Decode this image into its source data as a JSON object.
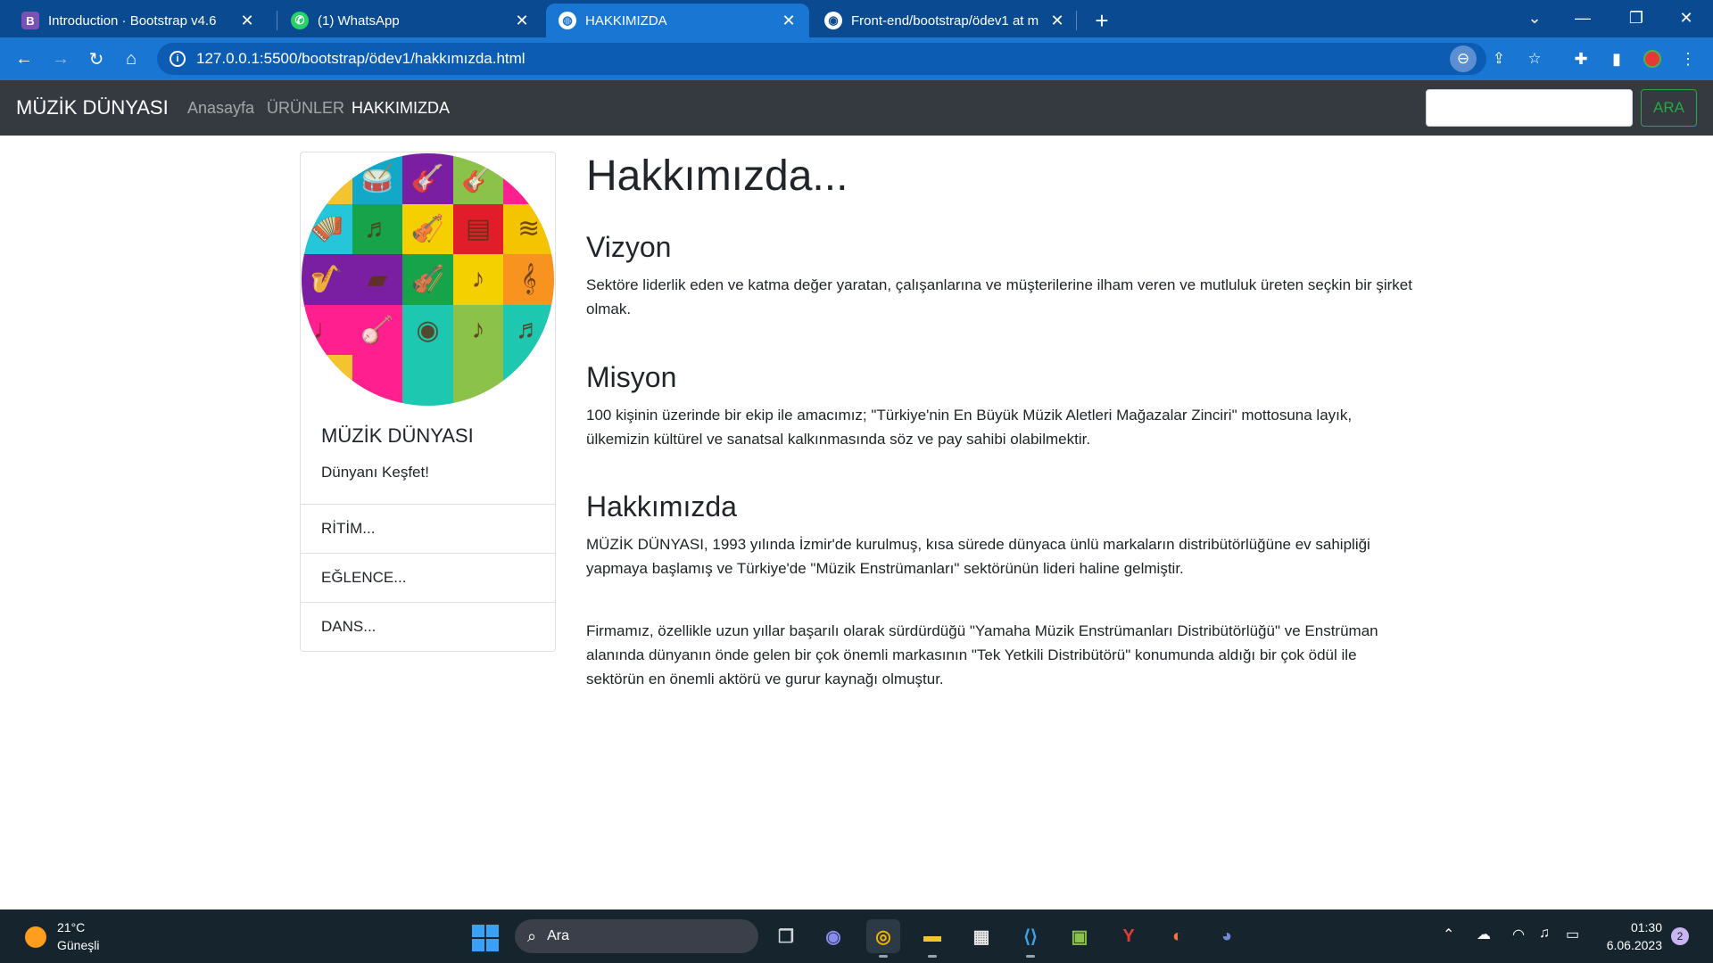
{
  "browser": {
    "tabs": [
      {
        "title": "Introduction · Bootstrap v4.6",
        "favicon": "bootstrap-icon",
        "color": "#7952b3"
      },
      {
        "title": "(1) WhatsApp",
        "favicon": "whatsapp-icon",
        "color": "#25d366"
      },
      {
        "title": "HAKKIMIZDA",
        "favicon": "globe-icon",
        "color": "#ffffff"
      },
      {
        "title": "Front-end/bootstrap/ödev1 at m",
        "favicon": "github-icon",
        "color": "#ffffff"
      }
    ],
    "active_tab": 2,
    "url": "127.0.0.1:5500/bootstrap/ödev1/hakkımızda.html"
  },
  "site": {
    "brand": "MÜZİK DÜNYASI",
    "nav": [
      {
        "label": "Anasayfa"
      },
      {
        "label": "ÜRÜNLER"
      },
      {
        "label": "HAKKIMIZDA"
      }
    ],
    "search_placeholder": "",
    "search_button": "ARA"
  },
  "card": {
    "title": "MÜZİK DÜNYASI",
    "text": "Dünyanı Keşfet!",
    "items": [
      {
        "label": "RİTİM..."
      },
      {
        "label": "EĞLENCE..."
      },
      {
        "label": "DANS..."
      }
    ]
  },
  "content": {
    "heading": "Hakkımızda...",
    "vizyon_title": "Vizyon",
    "vizyon_text": "Sektöre liderlik eden ve katma değer yaratan, çalışanlarına ve müşterilerine ilham veren ve mutluluk üreten seçkin bir şirket olmak.",
    "misyon_title": "Misyon",
    "misyon_text": "100 kişinin üzerinde bir ekip ile amacımız; \"Türkiye'nin En Büyük Müzik Aletleri Mağazalar Zinciri\" mottosuna layık, ülkemizin kültürel ve sanatsal kalkınmasında söz ve pay sahibi olabilmektir.",
    "hakkimizda_title": "Hakkımızda",
    "hakkimizda_text1": "MÜZİK DÜNYASI, 1993 yılında İzmir'de kurulmuş, kısa sürede dünyaca ünlü markaların distribütörlüğüne ev sahipliği yapmaya başlamış ve Türkiye'de \"Müzik Enstrümanları\" sektörünün lideri haline gelmiştir.",
    "hakkimizda_text2": "Firmamız, özellikle uzun yıllar başarılı olarak sürdürdüğü \"Yamaha Müzik Enstrümanları Distribütörlüğü\" ve Enstrüman alanında dünyanın önde gelen bir çok önemli markasının \"Tek Yetkili Distribütörü\" konumunda aldığı bir çok ödül ile sektörün en önemli aktörü ve gurur kaynağı olmuştur."
  },
  "taskbar": {
    "weather_temp": "21°C",
    "weather_desc": "Güneşli",
    "search_label": "Ara",
    "time": "01:30",
    "date": "6.06.2023",
    "notifications": "2"
  }
}
